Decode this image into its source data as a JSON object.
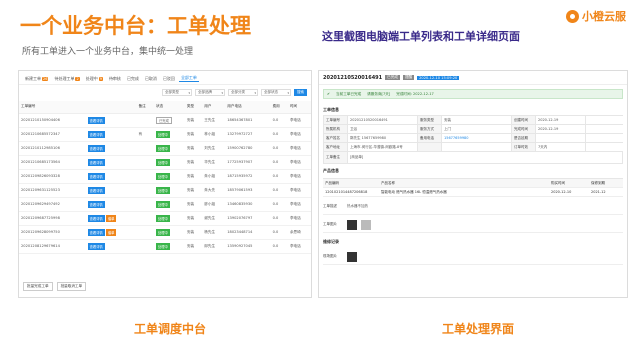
{
  "slide": {
    "title": "一个业务中台：工单处理",
    "subtitle": "所有工单进入一个业务中台，集中统一处理",
    "note": "这里截图电脑端工单列表和工单详细页面",
    "logo_text": "小橙云服",
    "caption_left": "工单调度中台",
    "caption_right": "工单处理界面",
    "accent_color": "#f08519",
    "note_color": "#3a2a8a"
  },
  "list_ui": {
    "tabs": [
      {
        "label": "新建工单",
        "count": "26"
      },
      {
        "label": "待处理工单",
        "count": "2"
      },
      {
        "label": "处理中",
        "count": "9"
      },
      {
        "label": "待审核",
        "count": ""
      },
      {
        "label": "已完成",
        "count": ""
      },
      {
        "label": "已取消",
        "count": ""
      },
      {
        "label": "已驳回",
        "count": ""
      },
      {
        "label": "全部工单",
        "count": ""
      }
    ],
    "filters": [
      "全部类型",
      "全部品牌",
      "全部分类",
      "全部状态"
    ],
    "search_label": "搜索",
    "columns": [
      "工单编号",
      "",
      "备注",
      "状态",
      "类型",
      "用户",
      "用户电话",
      "费用",
      "时间"
    ],
    "rows": [
      {
        "id": "20201210150904406",
        "action": "查看详情",
        "extra": "",
        "remark": "",
        "status": "已完成",
        "status_type": "gray",
        "type": "安装",
        "user": "王先生",
        "phone": "18654367801",
        "fee": "0.0",
        "time": "李电话"
      },
      {
        "id": "20201210685572347",
        "action": "查看详情",
        "extra": "",
        "remark": "有",
        "status": "处理中",
        "status_type": "green",
        "type": "安装",
        "user": "林小姐",
        "phone": "13279972727",
        "fee": "0.0",
        "time": "李电话"
      },
      {
        "id": "20201210112985106",
        "action": "查看详情",
        "extra": "",
        "remark": "",
        "status": "处理中",
        "status_type": "green",
        "type": "安装",
        "user": "刘先生",
        "phone": "15900762780",
        "fee": "0.0",
        "time": "李电话"
      },
      {
        "id": "20201210685173564",
        "action": "查看详情",
        "extra": "",
        "remark": "",
        "status": "处理中",
        "status_type": "green",
        "type": "安装",
        "user": "华先生",
        "phone": "17725937907",
        "fee": "0.0",
        "time": "李电话"
      },
      {
        "id": "20201209826093328",
        "action": "查看详情",
        "extra": "",
        "remark": "",
        "status": "处理中",
        "status_type": "green",
        "type": "安装",
        "user": "朱小姐",
        "phone": "18715935972",
        "fee": "0.0",
        "time": "李电话"
      },
      {
        "id": "20201209631125523",
        "action": "查看详情",
        "extra": "",
        "remark": "",
        "status": "处理中",
        "status_type": "green",
        "type": "安装",
        "user": "朱大先",
        "phone": "18579061593",
        "fee": "0.0",
        "time": "李电话"
      },
      {
        "id": "20201209629497492",
        "action": "查看详情",
        "extra": "",
        "remark": "",
        "status": "处理中",
        "status_type": "green",
        "type": "安装",
        "user": "廖小姐",
        "phone": "13460835930",
        "fee": "0.0",
        "time": "李电话"
      },
      {
        "id": "20201209687725998",
        "action": "查看详情",
        "extra": "催单",
        "remark": "",
        "status": "处理中",
        "status_type": "green",
        "type": "安装",
        "user": "谢先生",
        "phone": "13902076797",
        "fee": "0.0",
        "time": "李电话"
      },
      {
        "id": "20201209628099750",
        "action": "查看详情",
        "extra": "催单",
        "remark": "",
        "status": "处理中",
        "status_type": "green",
        "type": "安装",
        "user": "杨先生",
        "phone": "18023448714",
        "fee": "0.0",
        "time": "余思琦"
      },
      {
        "id": "20201208129679614",
        "action": "查看详情",
        "extra": "",
        "remark": "",
        "status": "处理中",
        "status_type": "green",
        "type": "安装",
        "user": "邱先生",
        "phone": "13590927045",
        "fee": "0.0",
        "time": "李电话"
      }
    ],
    "bulk_buttons": [
      "批量完成工单",
      "批量取消工单"
    ]
  },
  "detail_ui": {
    "order_no": "20201210520016491",
    "badge_1": "已完成",
    "badge_2": "提醒",
    "badge_3": "2020-12-10 15:09:20",
    "banner_status": "当前工单已完成",
    "banner_by": "请服务商[7天]",
    "banner_time": "完成时间: 2022-12-17",
    "section_info": "工单信息",
    "info_rows": [
      [
        {
          "label": "工单编号",
          "value": "20201210520016491"
        },
        {
          "label": "服务类型",
          "value": "安装"
        },
        {
          "label": "创建时间",
          "value": "2020-12-19"
        }
      ],
      [
        {
          "label": "所属机构",
          "value": "卫浴"
        },
        {
          "label": "服务方式",
          "value": "上门"
        },
        {
          "label": "完成时间",
          "value": "2020-12-19"
        }
      ],
      [
        {
          "label": "客户姓名",
          "value": "郭先生 15677659980"
        },
        {
          "label": "备用电话",
          "value": "15677659980"
        },
        {
          "label": "是否延期",
          "value": ""
        }
      ],
      [
        {
          "label": "客户地址",
          "value": "上海市-闵行区-华漕镇-闵欧路-8号"
        },
        {
          "label": "",
          "value": ""
        },
        {
          "label": "订单时效",
          "value": "7天内"
        }
      ]
    ],
    "remark_label": "工单备注",
    "remark_value": "[商品单]",
    "section_product": "产品信息",
    "product_head": [
      "产品编码",
      "产品名称",
      "购买时间",
      "保修到期"
    ],
    "product_row": [
      "1201021014487206818",
      "智能电动 燃气热水器 16L 恒温燃气热水器",
      "2020-12-10",
      "2021-12"
    ],
    "desc_label": "工单描述",
    "desc_value": "热水器不加热",
    "img_label": "工单图片",
    "section_record": "维修记录",
    "record_label": "现场图片"
  }
}
